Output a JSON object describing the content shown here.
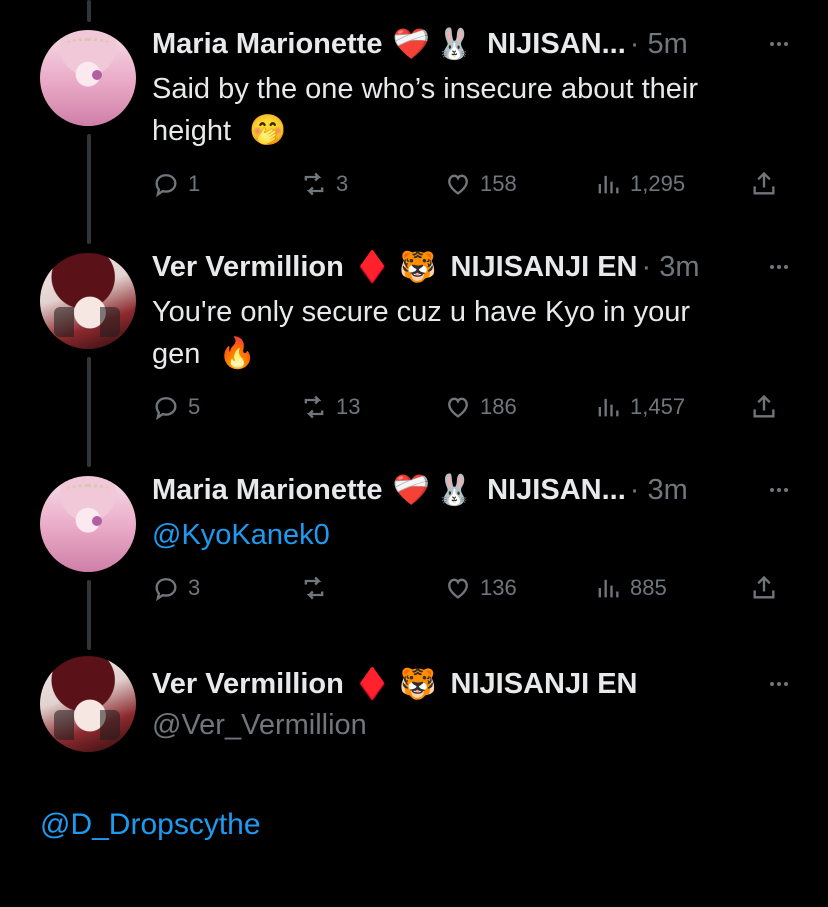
{
  "tweets": [
    {
      "name": "Maria Marionette",
      "emoji1": "❤️‍🩹",
      "emoji2": "🐰",
      "affiliation": "NIJISAN...",
      "time": "· 5m",
      "text_line1": "Said by the one who’s insecure about their",
      "text_line2": "height",
      "text_emoji": "🤭",
      "replies": "1",
      "retweets": "3",
      "likes": "158",
      "views": "1,295"
    },
    {
      "name": "Ver Vermillion",
      "emoji1": "♦️",
      "emoji2": "🐯",
      "affiliation": "NIJISANJI EN",
      "time": "· 3m",
      "text_line1": "You're only secure cuz u have Kyo in your",
      "text_line2": "gen",
      "text_emoji": "🔥",
      "replies": "5",
      "retweets": "13",
      "likes": "186",
      "views": "1,457"
    },
    {
      "name": "Maria Marionette",
      "emoji1": "❤️‍🩹",
      "emoji2": "🐰",
      "affiliation": "NIJISAN...",
      "time": "· 3m",
      "mention": "@KyoKanek0",
      "replies": "3",
      "retweets": "",
      "likes": "136",
      "views": "885"
    },
    {
      "name": "Ver Vermillion",
      "emoji1": "♦️",
      "emoji2": "🐯",
      "affiliation": "NIJISANJI EN",
      "handle": "@Ver_Vermillion"
    }
  ],
  "final_mention": "@D_Dropscythe",
  "colors": {
    "background": "#000000",
    "text": "#e7e9ea",
    "muted": "#71767b",
    "link": "#1d9bf0"
  },
  "icons": [
    "reply-icon",
    "retweet-icon",
    "like-icon",
    "views-icon",
    "share-icon",
    "more-icon"
  ]
}
